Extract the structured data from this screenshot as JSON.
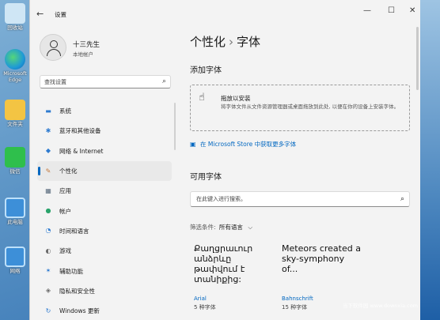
{
  "window": {
    "title": "设置",
    "back_glyph": "←",
    "minimize_glyph": "—",
    "maximize_glyph": "☐",
    "close_glyph": "✕"
  },
  "desktop": {
    "icons": [
      {
        "label": "回收站",
        "icon": "recycle-bin-icon",
        "color": "#cfe6f5"
      },
      {
        "label": "Microsoft Edge",
        "icon": "edge-icon",
        "color": "#1f9ad6"
      },
      {
        "label": "文件夹",
        "icon": "folder-icon",
        "color": "#f3c443"
      },
      {
        "label": "微信",
        "icon": "wechat-icon",
        "color": "#2fbf4c"
      },
      {
        "label": "此电脑",
        "icon": "computer-icon",
        "color": "#3d8fd8"
      },
      {
        "label": "网络",
        "icon": "network-icon",
        "color": "#3d8fd8"
      }
    ]
  },
  "user": {
    "name": "十三先生",
    "account_type": "本地帐户"
  },
  "sidebar": {
    "search_placeholder": "查找设置",
    "items": [
      {
        "label": "系统",
        "icon": "monitor-icon",
        "active": false,
        "color": "#2e7bd0",
        "glyph": "▬"
      },
      {
        "label": "蓝牙和其他设备",
        "icon": "bluetooth-icon",
        "active": false,
        "color": "#2e7bd0",
        "glyph": "✱"
      },
      {
        "label": "网络 & Internet",
        "icon": "wifi-icon",
        "active": false,
        "color": "#2e7bd0",
        "glyph": "◆"
      },
      {
        "label": "个性化",
        "icon": "pen-icon",
        "active": true,
        "color": "#c4783b",
        "glyph": "✎"
      },
      {
        "label": "应用",
        "icon": "apps-icon",
        "active": false,
        "color": "#5a6b7d",
        "glyph": "▦"
      },
      {
        "label": "帐户",
        "icon": "account-icon",
        "active": false,
        "color": "#2aa36b",
        "glyph": "●"
      },
      {
        "label": "时间和语言",
        "icon": "globe-clock-icon",
        "active": false,
        "color": "#2e7bd0",
        "glyph": "◔"
      },
      {
        "label": "游戏",
        "icon": "gamepad-icon",
        "active": false,
        "color": "#6b6b6b",
        "glyph": "◐"
      },
      {
        "label": "辅助功能",
        "icon": "accessibility-icon",
        "active": false,
        "color": "#2e7bd0",
        "glyph": "✶"
      },
      {
        "label": "隐私和安全性",
        "icon": "shield-icon",
        "active": false,
        "color": "#6b6b6b",
        "glyph": "◈"
      },
      {
        "label": "Windows 更新",
        "icon": "update-icon",
        "active": false,
        "color": "#2e7bd0",
        "glyph": "↻"
      }
    ]
  },
  "main": {
    "breadcrumb_parent": "个性化",
    "breadcrumb_sep": "›",
    "breadcrumb_current": "字体",
    "add_font_heading": "添加字体",
    "drop_title": "拖放以安装",
    "drop_desc": "将字体文件从文件资源管理器或桌面拖放到此处, 以便在你的设备上安装字体。",
    "store_link": "在 Microsoft Store 中获取更多字体",
    "available_heading": "可用字体",
    "font_search_placeholder": "在此键入进行搜索。",
    "filter_label": "筛选条件:",
    "filter_value": "所有语言",
    "font_cards": [
      {
        "sample": "Քաղցրաւուր անձրևը թափվում է տանիքից:",
        "name": "Arial",
        "count": "5 种字体"
      },
      {
        "sample": "Meteors created a sky-symphony of...",
        "name": "Bahnschrift",
        "count": "15 种字体"
      }
    ]
  },
  "watermark": "当下软件园 www.downxia.com"
}
